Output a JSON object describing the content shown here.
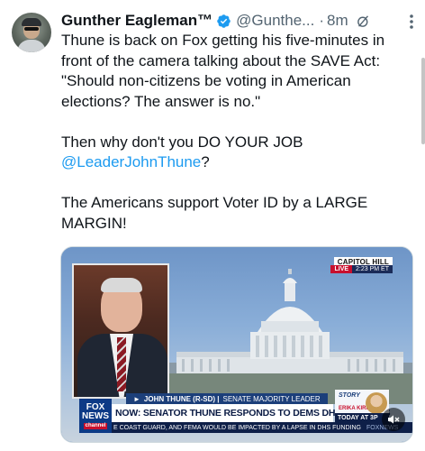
{
  "tweet": {
    "author_name": "Gunther Eagleman™",
    "handle": "@Gunthe...",
    "separator": "·",
    "time": "8m",
    "text_lines": [
      "Thune is back on Fox getting his five-minutes in",
      "front of the camera talking about the SAVE Act:",
      "\"Should non-citizens be voting in American",
      "elections? The answer is no.\""
    ],
    "paragraph2_prefix": "Then why don't you DO YOUR JOB",
    "mention": "@LeaderJohnThune",
    "paragraph2_suffix": "?",
    "paragraph3_line1": "The Americans support Voter ID by a LARGE",
    "paragraph3_line2": "MARGIN!"
  },
  "media": {
    "location_label": "CAPITOL HILL",
    "live_label": "LIVE",
    "live_time": "2:23 PM ET",
    "lower_third_name": "JOHN THUNE (R-SD)",
    "lower_third_title": "SENATE MAJORITY LEADER",
    "lower_third_arrow": "►",
    "headline": "NOW: SENATOR THUNE RESPONDS TO DEMS DHS DEMANDS",
    "ticker": "E COAST GUARD, AND FEMA WOULD BE IMPACTED BY A LAPSE IN DHS FUNDING",
    "ticker_source": "FOXNEWS",
    "network_line1": "FOX",
    "network_line2": "NEWS",
    "network_sub": "channel",
    "story_label": "STORY",
    "story_sub": "ERIKA KIRK",
    "today_label": "TODAY AT 3P"
  },
  "icons": {
    "verified": "verified-badge-icon",
    "grok": "grok-icon",
    "more": "more-options-icon",
    "mute": "mute-icon"
  },
  "colors": {
    "accent": "#1d9bf0",
    "text": "#0f1419",
    "secondary": "#536471"
  }
}
